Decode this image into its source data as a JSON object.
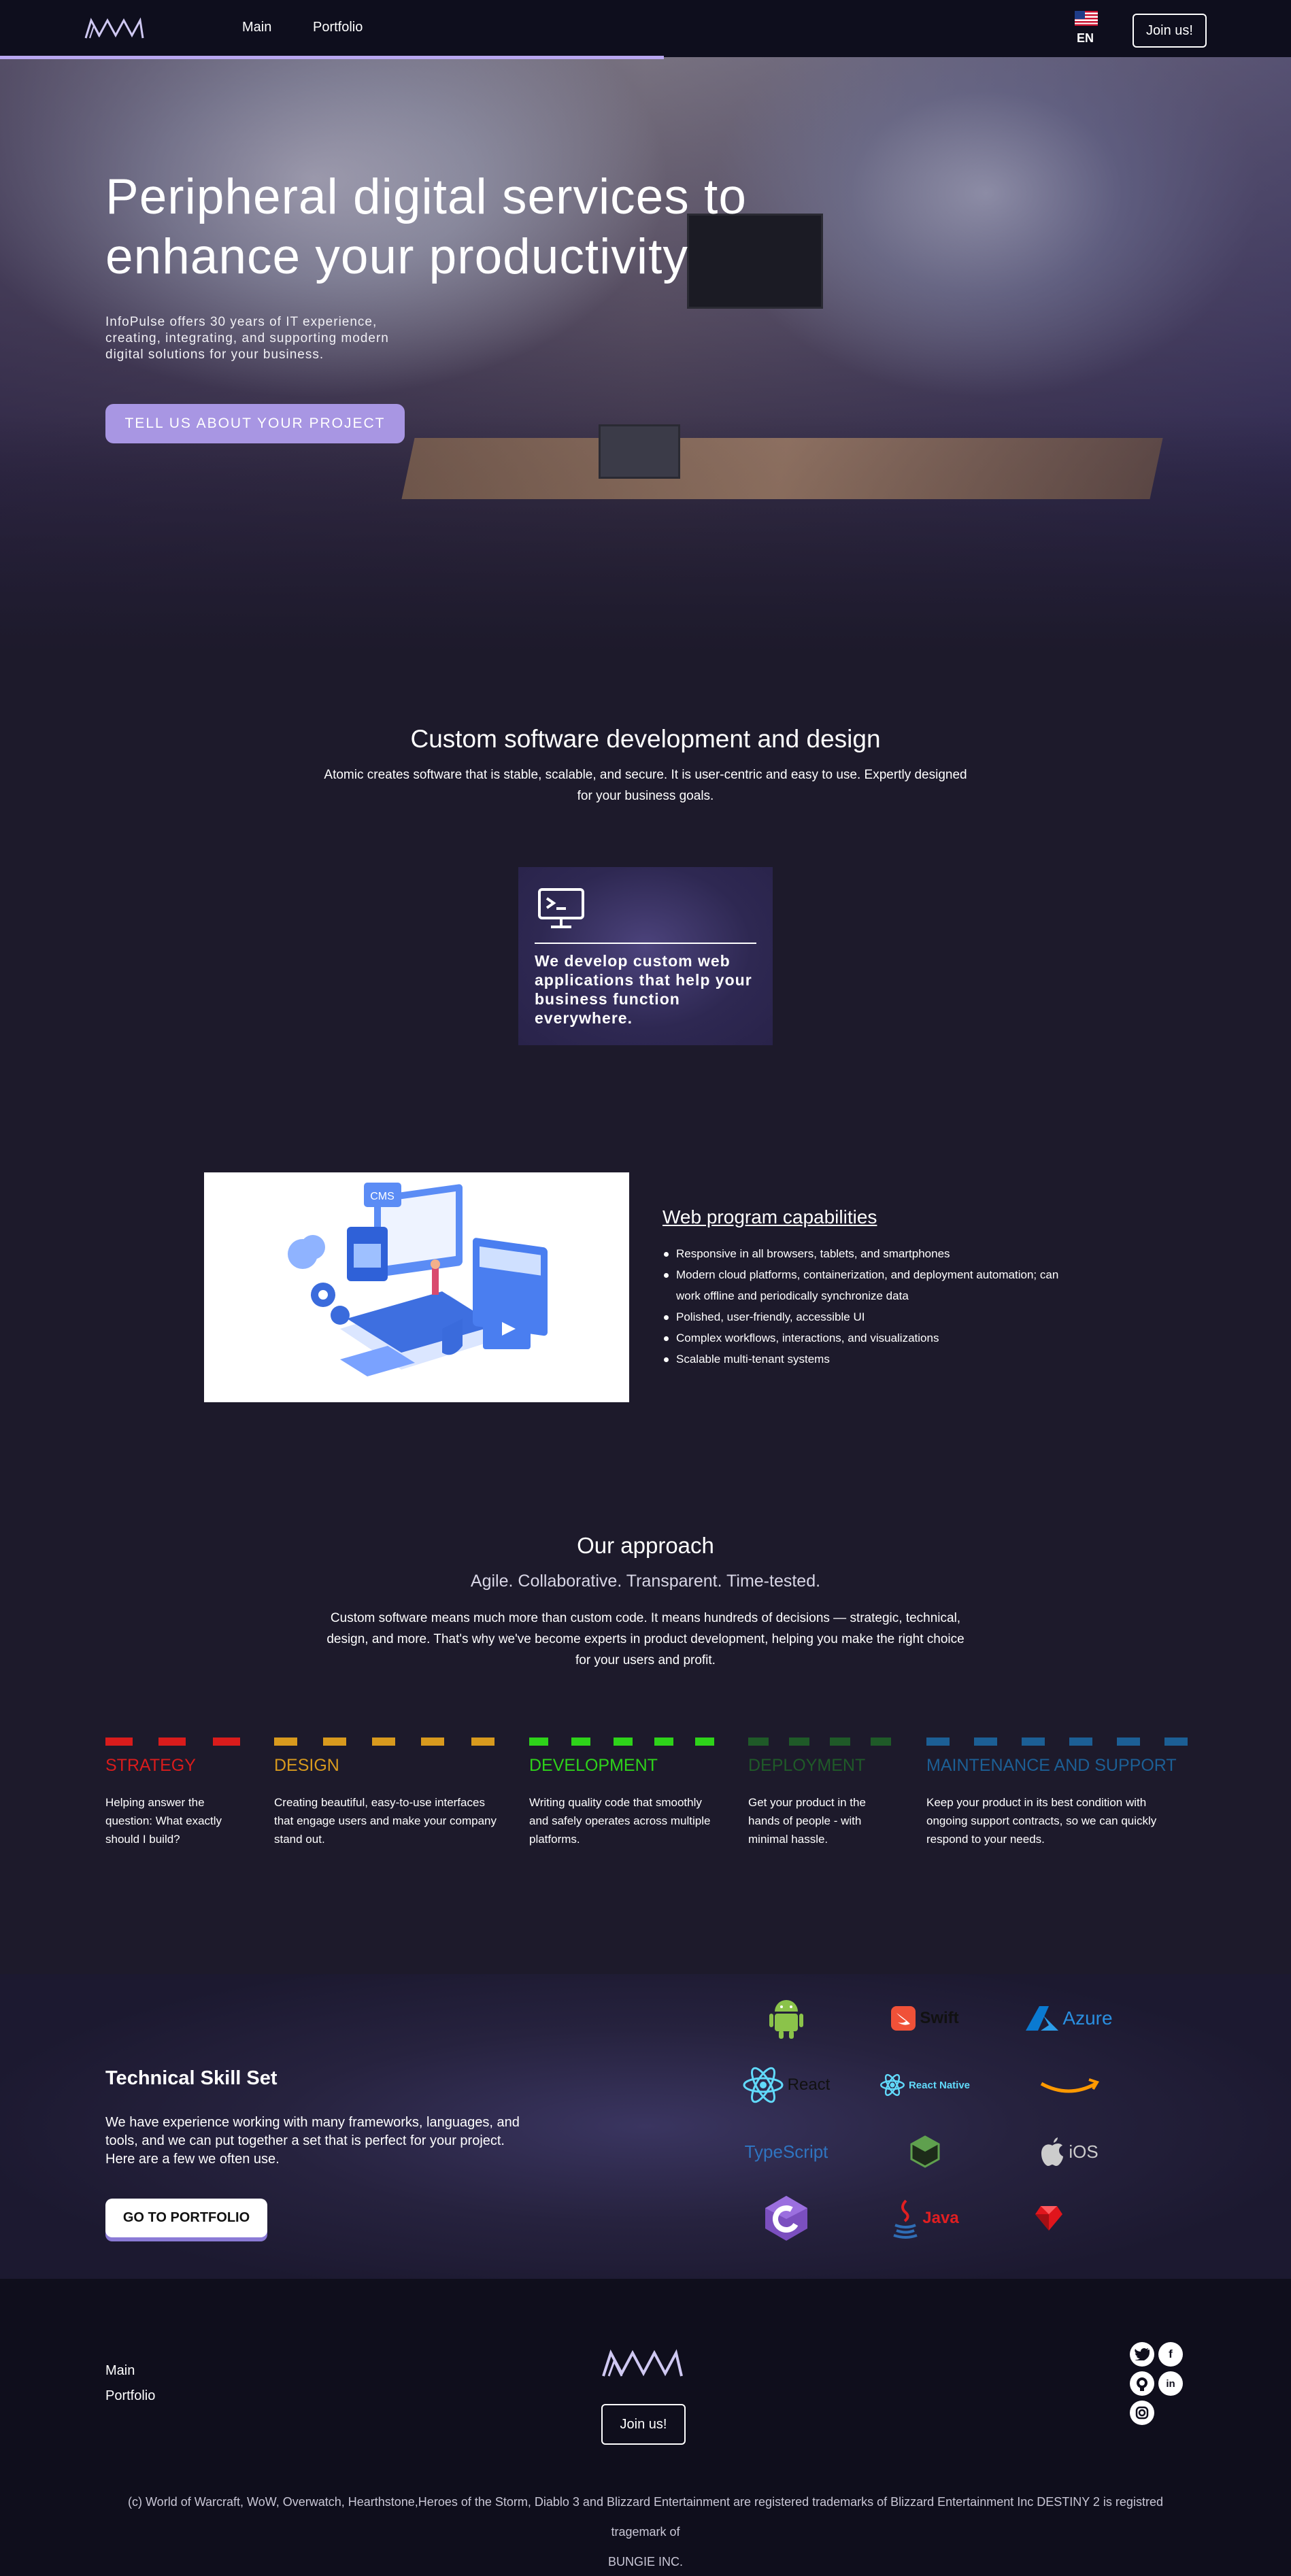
{
  "nav": {
    "links": [
      "Main",
      "Portfolio"
    ],
    "language": "EN",
    "join_label": "Join us!"
  },
  "hero": {
    "title_line1": "Peripheral digital services to",
    "title_line2": "enhance your productivity",
    "description": "InfoPulse offers 30 years of IT experience, creating, integrating, and supporting modern digital solutions for your business.",
    "cta_label": "TELL US ABOUT YOUR PROJECT"
  },
  "custom": {
    "title": "Custom software development and design",
    "text_line1": "Atomic creates software that is stable, scalable, and secure. It is user-centric and easy to use. Expertly designed",
    "text_line2": "for your business goals.",
    "card_text": "We develop custom web applications that help your business function everywhere.",
    "card_icon": "terminal-monitor-icon"
  },
  "web_program": {
    "illustration_badge": "CMS",
    "title": "Web program capabilities",
    "items": [
      "Responsive in all browsers, tablets, and smartphones",
      "Modern cloud platforms, containerization, and deployment automation; can work offline and periodically synchronize data",
      "Polished, user-friendly, accessible UI",
      "Complex workflows, interactions, and visualizations",
      "Scalable multi-tenant systems"
    ]
  },
  "approach": {
    "title": "Our approach",
    "subtitle": "Agile. Collaborative. Transparent. Time-tested.",
    "text_line1": "Custom software means much more than custom code. It means hundreds of decisions — strategic, technical,",
    "text_line2": "design, and more. That's why we've become experts in product development, helping you make the right choice",
    "text_line3": "for your users and profit.",
    "stages": [
      {
        "name": "STRATEGY",
        "color": "#d91c1c",
        "text": "Helping answer the question: What exactly should I build?"
      },
      {
        "name": "DESIGN",
        "color": "#d89a1e",
        "text": "Creating beautiful, easy-to-use interfaces that engage users and make your company stand out."
      },
      {
        "name": "DEVELOPMENT",
        "color": "#2ed31a",
        "text": "Writing quality code that smoothly and safely operates across multiple platforms."
      },
      {
        "name": "DEPLOYMENT",
        "color": "#1f5a28",
        "text": "Get your product in the hands of people - with minimal hassle."
      },
      {
        "name": "MAINTENANCE AND SUPPORT",
        "color": "#1c5f95",
        "text": "Keep your product in its best condition with ongoing support contracts, so we can quickly respond to your needs."
      }
    ]
  },
  "skills": {
    "title": "Technical Skill Set",
    "text": "We have experience working with many frameworks, languages, and tools, and we can put together a set that is perfect for your project. Here are a few we often use.",
    "portfolio_label": "GO TO PORTFOLIO",
    "logos": [
      {
        "icon": "android-icon",
        "label": "",
        "color": "#8bc34a"
      },
      {
        "icon": "swift-icon",
        "label": "Swift",
        "color": "#f05138"
      },
      {
        "icon": "azure-icon",
        "label": "Azure",
        "color": "#0a7ad1"
      },
      {
        "icon": "react-icon",
        "label": "React",
        "color": "#61dafb"
      },
      {
        "icon": "react-native-icon",
        "label": "React Native",
        "color": "#61dafb"
      },
      {
        "icon": "amazon-icon",
        "label": "",
        "color": "#ff9900"
      },
      {
        "icon": "typescript-icon",
        "label": "TypeScript",
        "color": "#2f74c0"
      },
      {
        "icon": "nodejs-icon",
        "label": "",
        "color": "#5fa04e"
      },
      {
        "icon": "apple-ios-icon",
        "label": "iOS",
        "color": "#cccccc"
      },
      {
        "icon": "csharp-icon",
        "label": "",
        "color": "#7b4fbf"
      },
      {
        "icon": "java-icon",
        "label": "Java",
        "color": "#e11f21"
      },
      {
        "icon": "ruby-icon",
        "label": "",
        "color": "#e0151c"
      }
    ]
  },
  "footer": {
    "links": [
      "Main",
      "Portfolio"
    ],
    "join_label": "Join us!",
    "social": [
      "twitter-icon",
      "facebook-icon",
      "github-icon",
      "linkedin-icon",
      "instagram-icon"
    ],
    "copyright_line1": "(c) World of Warcraft, WoW, Overwatch, Hearthstone,Heroes of the Storm, Diablo 3 and Blizzard Entertainment are registered trademarks of Blizzard Entertainment Inc DESTINY 2 is registred tragemark of",
    "copyright_line2": "BUNGIE INC."
  }
}
